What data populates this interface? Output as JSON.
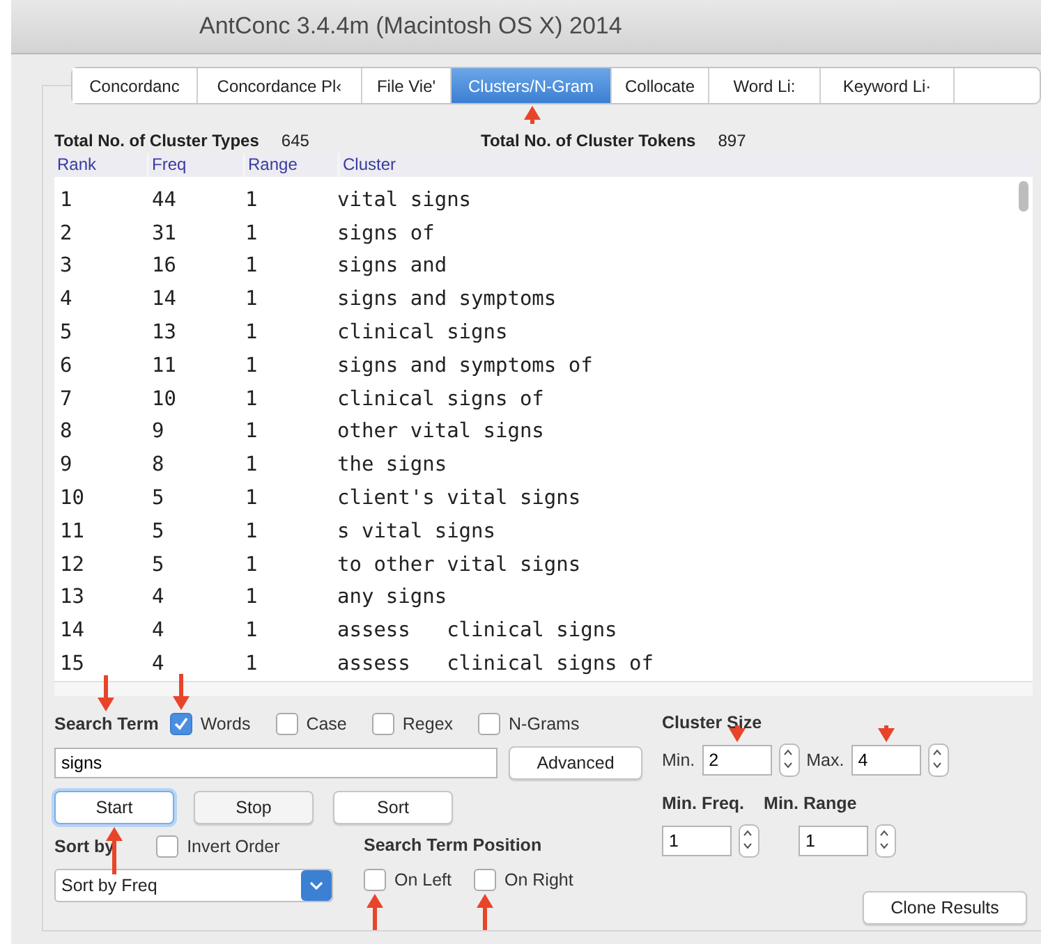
{
  "window": {
    "title": "AntConc 3.4.4m (Macintosh OS X) 2014"
  },
  "tabs": [
    {
      "label": "Concordanc",
      "selected": false,
      "marked": false
    },
    {
      "label": "Concordance Pl‹",
      "selected": false,
      "marked": false
    },
    {
      "label": "File Vie'",
      "selected": false,
      "marked": false
    },
    {
      "label": "Clusters/N-Gram",
      "selected": true,
      "marked": true
    },
    {
      "label": "Collocate",
      "selected": false,
      "marked": false
    },
    {
      "label": "Word Li:",
      "selected": false,
      "marked": false
    },
    {
      "label": "Keyword Li·",
      "selected": false,
      "marked": false
    }
  ],
  "totals": [
    {
      "label": "Total No. of Cluster Types",
      "value": "645"
    },
    {
      "label": "Total No. of Cluster Tokens",
      "value": "897"
    }
  ],
  "table": {
    "columns": [
      "Rank",
      "Freq",
      "Range",
      "Cluster"
    ],
    "rows": [
      [
        "1",
        "44",
        "1",
        "vital signs"
      ],
      [
        "2",
        "31",
        "1",
        "signs of"
      ],
      [
        "3",
        "16",
        "1",
        "signs and"
      ],
      [
        "4",
        "14",
        "1",
        "signs and symptoms"
      ],
      [
        "5",
        "13",
        "1",
        "clinical signs"
      ],
      [
        "6",
        "11",
        "1",
        "signs and symptoms of"
      ],
      [
        "7",
        "10",
        "1",
        "clinical signs of"
      ],
      [
        "8",
        "9",
        "1",
        "other vital signs"
      ],
      [
        "9",
        "8",
        "1",
        "the signs"
      ],
      [
        "10",
        "5",
        "1",
        "client's vital signs"
      ],
      [
        "11",
        "5",
        "1",
        "s vital signs"
      ],
      [
        "12",
        "5",
        "1",
        "to other vital signs"
      ],
      [
        "13",
        "4",
        "1",
        "any signs"
      ],
      [
        "14",
        "4",
        "1",
        "assess   clinical signs"
      ],
      [
        "15",
        "4",
        "1",
        "assess   clinical signs of"
      ]
    ]
  },
  "search": {
    "label": "Search Term",
    "marked": true,
    "value": "signs",
    "advanced": "Advanced",
    "options": [
      {
        "label": "Words",
        "checked": true,
        "marked": true
      },
      {
        "label": "Case",
        "checked": false,
        "marked": false
      },
      {
        "label": "Regex",
        "checked": false,
        "marked": false
      },
      {
        "label": "N-Grams",
        "checked": false,
        "marked": false
      }
    ]
  },
  "buttons": [
    {
      "label": "Start",
      "focused": true,
      "marked": true
    },
    {
      "label": "Stop",
      "focused": false,
      "marked": false
    },
    {
      "label": "Sort",
      "focused": false,
      "marked": false
    }
  ],
  "sort": {
    "label": "Sort by",
    "invert": {
      "label": "Invert Order",
      "checked": false
    },
    "select": "Sort by Freq"
  },
  "position": {
    "label": "Search Term Position",
    "options": [
      {
        "label": "On Left",
        "checked": false,
        "marked": true
      },
      {
        "label": "On Right",
        "checked": false,
        "marked": true
      }
    ]
  },
  "cluster_size": {
    "label": "Cluster Size",
    "min": {
      "label": "Min.",
      "value": "2",
      "marked": true
    },
    "max": {
      "label": "Max.",
      "value": "4",
      "marked": true
    }
  },
  "min_freq": {
    "label": "Min. Freq.",
    "value": "1"
  },
  "min_range": {
    "label": "Min. Range",
    "value": "1"
  },
  "clone": "Clone Results"
}
